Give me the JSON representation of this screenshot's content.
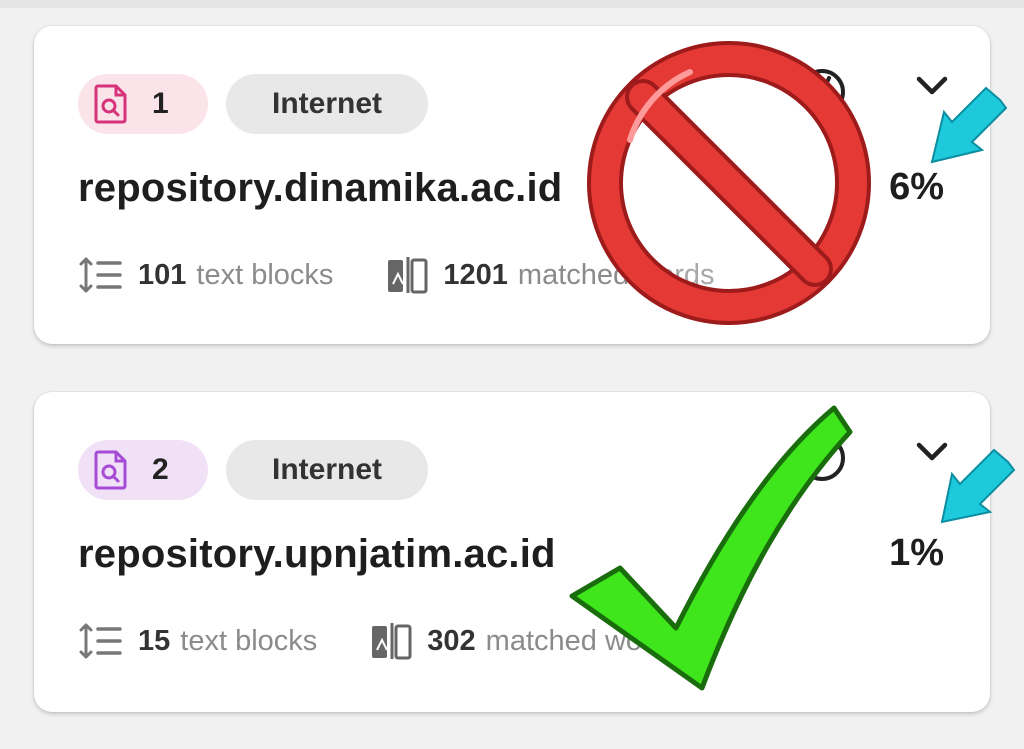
{
  "results": [
    {
      "index": "1",
      "source": "Internet",
      "domain": "repository.dinamika.ac.id",
      "percent": "6%",
      "blocks_count": "101",
      "blocks_label": "text blocks",
      "words_count": "1201",
      "words_label": "matched words",
      "accent": "#d6337a"
    },
    {
      "index": "2",
      "source": "Internet",
      "domain": "repository.upnjatim.ac.id",
      "percent": "1%",
      "blocks_count": "15",
      "blocks_label": "text blocks",
      "words_count": "302",
      "words_label": "matched words",
      "accent": "#a64bd6"
    }
  ],
  "icons": {
    "index_badge": "document-search-icon",
    "settings": "gear-icon",
    "expand": "chevron-down-icon",
    "blocks": "text-blocks-icon",
    "words": "matched-words-icon"
  },
  "annotations": {
    "prohibited": "no-symbol-icon",
    "approved": "checkmark-icon",
    "pointer": "arrow-icon",
    "colors": {
      "prohibited": "#e53935",
      "approved": "#3ee61b",
      "pointer": "#1ec9dc"
    }
  }
}
